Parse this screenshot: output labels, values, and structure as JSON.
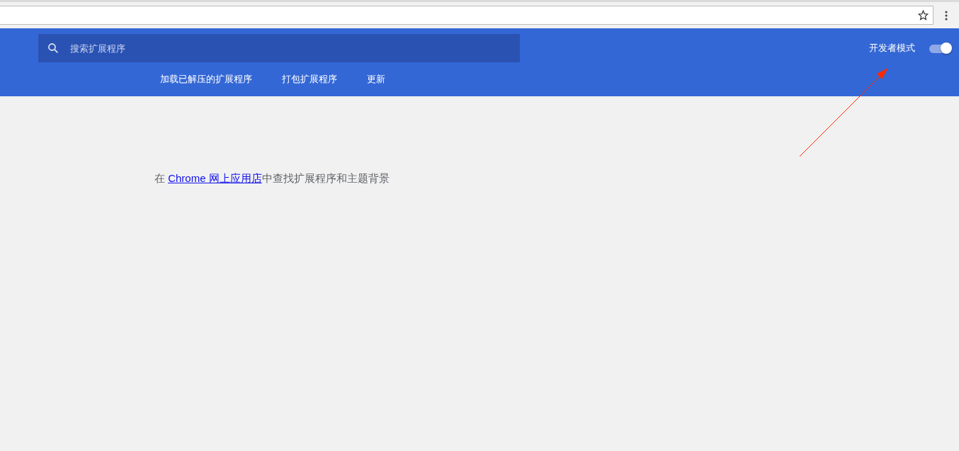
{
  "header": {
    "search": {
      "placeholder": "搜索扩展程序"
    },
    "developer_mode": {
      "label": "开发者模式",
      "on": true
    },
    "actions": [
      {
        "label": "加载已解压的扩展程序"
      },
      {
        "label": "打包扩展程序"
      },
      {
        "label": "更新"
      }
    ]
  },
  "store_prompt": {
    "before": "在 ",
    "link": "Chrome 网上应用店",
    "after": "中查找扩展程序和主题背景"
  },
  "annotation": {
    "kind": "arrow"
  }
}
